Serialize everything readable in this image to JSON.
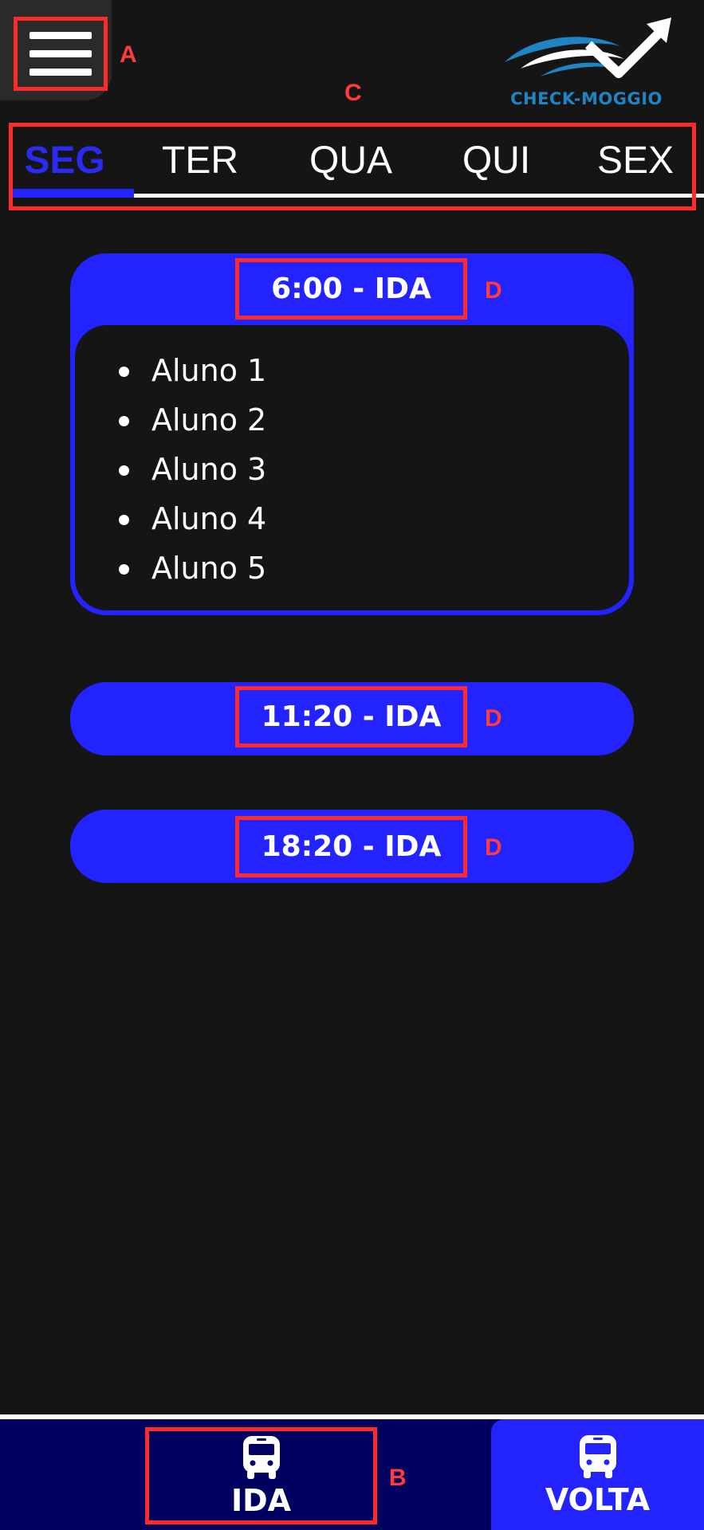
{
  "header": {
    "menu_icon": "hamburger-icon",
    "logo_text": "CHECK-MOGGIO",
    "logo_colors": {
      "primary": "#1e84c4",
      "secondary": "#ffffff"
    }
  },
  "annotations": {
    "a": "A",
    "b": "B",
    "c": "C",
    "d": "D"
  },
  "tabs": [
    {
      "label": "SEG",
      "active": true
    },
    {
      "label": "TER",
      "active": false
    },
    {
      "label": "QUA",
      "active": false
    },
    {
      "label": "QUI",
      "active": false
    },
    {
      "label": "SEX",
      "active": false
    }
  ],
  "schedules": [
    {
      "title": "6:00 - IDA",
      "expanded": true,
      "students": [
        "Aluno 1",
        "Aluno 2",
        "Aluno 3",
        "Aluno 4",
        "Aluno 5"
      ]
    },
    {
      "title": "11:20 - IDA",
      "expanded": false
    },
    {
      "title": "18:20 - IDA",
      "expanded": false
    }
  ],
  "bottom_nav": {
    "ida": {
      "label": "IDA",
      "icon": "bus-icon",
      "active": true
    },
    "volta": {
      "label": "VOLTA",
      "icon": "bus-icon",
      "active": false
    }
  },
  "colors": {
    "background": "#151515",
    "accent": "#2323ff",
    "nav_dark": "#00005e",
    "highlight_box": "#ff2b2b"
  }
}
